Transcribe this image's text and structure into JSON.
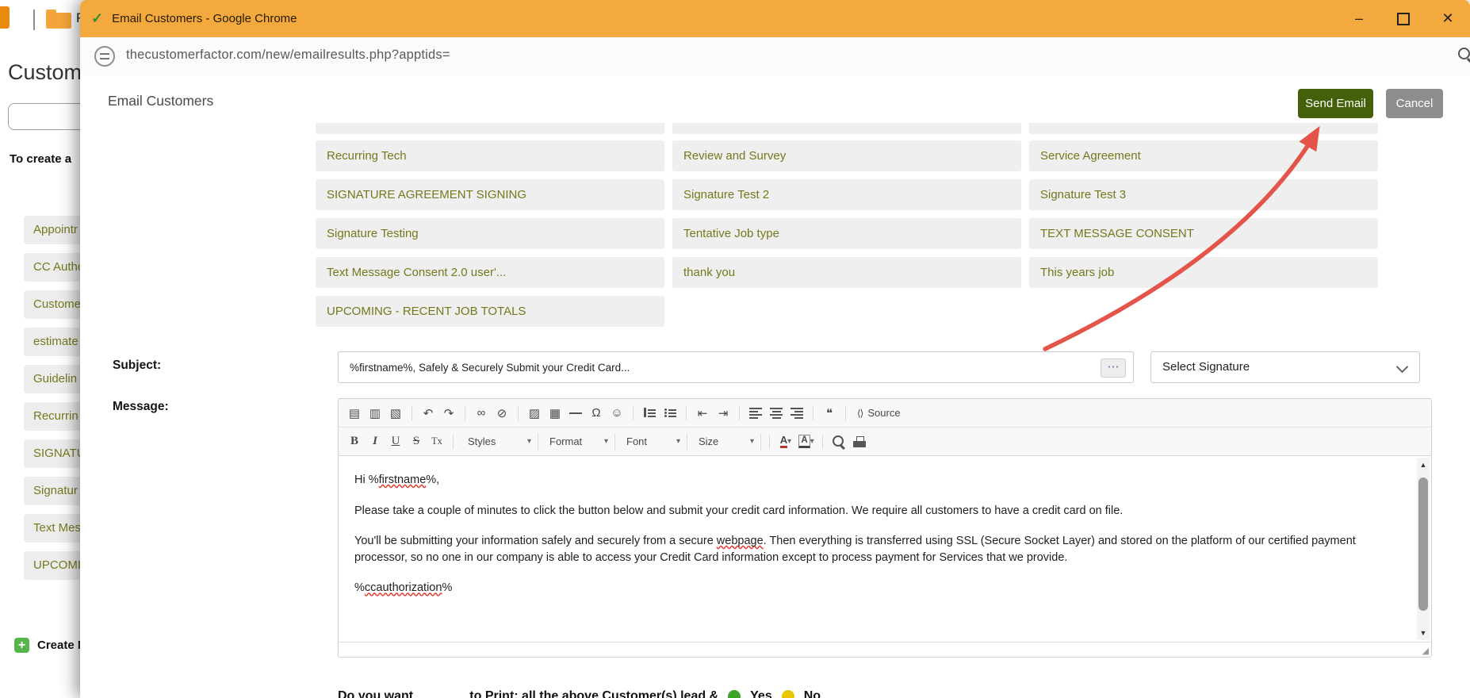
{
  "window": {
    "title": "Email Customers - Google Chrome",
    "minimize_glyph": "–",
    "close_glyph": "✕"
  },
  "browser": {
    "url": "thecustomerfactor.com/new/emailresults.php?apptids="
  },
  "background_page": {
    "tab_label": "P",
    "page_title": "Custom",
    "intro_text": "To create a",
    "sidebar_items": [
      "Appointr",
      "CC Autho",
      "Custome",
      "estimate",
      "Guidelin",
      "Recurrin",
      "SIGNATU",
      "Signatur",
      "Text Mes",
      "UPCOMIN"
    ],
    "create_label": "Create N",
    "plus_glyph": "+"
  },
  "dialog": {
    "title": "Email Customers",
    "send_label": "Send Email",
    "cancel_label": "Cancel",
    "templates": [
      "Recurring Tech",
      "Review and Survey",
      "Service Agreement",
      "SIGNATURE AGREEMENT SIGNING",
      "Signature Test 2",
      "Signature Test 3",
      "Signature Testing",
      "Tentative Job type",
      "TEXT MESSAGE CONSENT",
      "Text Message Consent 2.0 user'...",
      "thank you",
      "This years job",
      "UPCOMING - RECENT JOB TOTALS"
    ],
    "subject_label": "Subject:",
    "subject_value": "%firstname%, Safely & Securely Submit your Credit Card...",
    "subject_more_glyph": "⋯",
    "signature_value": "Select Signature",
    "message_label": "Message:",
    "editor": {
      "source_label": "Source",
      "styles_label": "Styles",
      "format_label": "Format",
      "font_label": "Font",
      "size_label": "Size",
      "p1a": "Hi %",
      "p1b": "firstname",
      "p1c": "%,",
      "p2": "Please take a couple of minutes to click the button below and submit your credit card information. We require all customers to have a credit card on file.",
      "p3a": "You'll be submitting your information safely and securely from a secure ",
      "p3b": "webpage",
      "p3c": ". Then everything is transferred using SSL (Secure Socket Layer) and stored on the platform of our certified payment processor, so no one in our company is able to access your Credit Card information except to process payment for Services that we provide.",
      "p4a": "%",
      "p4b": "ccauthorization",
      "p4c": "%"
    },
    "footer": {
      "question": "Do you want _______ to Print: all the above Customer(s) lead &",
      "yes_label": "Yes",
      "no_label": "No"
    }
  },
  "icons": {
    "favicon": "✓",
    "paste": "▤",
    "paste_plain": "▥",
    "paste_word": "▧",
    "undo": "↶",
    "redo": "↷",
    "link": "∞",
    "unlink": "⊘",
    "image": "▨",
    "table": "▦",
    "omega": "Ω",
    "smiley": "☺",
    "outdent": "⇤",
    "indent": "⇥",
    "quote": "❝",
    "source": "⟨⟩",
    "bold": "B",
    "italic": "I",
    "underline": "U",
    "strike": "S",
    "removeformat": "Tx",
    "color_a": "A",
    "caret": "▾",
    "resize": "◢",
    "scroll_up": "▲",
    "scroll_down": "▼"
  },
  "colors": {
    "titlebar": "#f3a93d",
    "template_text": "#75781c",
    "send_button": "#44600b",
    "cancel_button": "#8d8d8d",
    "arrow": "#e4544a",
    "spellcheck": "#e0382e"
  }
}
